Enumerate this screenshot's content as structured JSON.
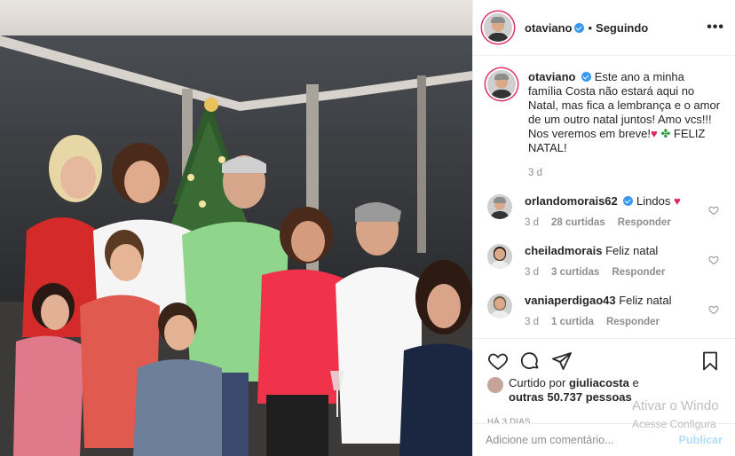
{
  "header": {
    "username": "otaviano",
    "separator": "•",
    "follow_status": "Seguindo",
    "more": "•••"
  },
  "caption": {
    "username": "otaviano",
    "text": "Este ano a minha família Costa não estará aqui no Natal, mas fica a lembrança e o amor de um outro natal juntos! Amo vcs!!! Nos veremos em breve!",
    "heart": "♥",
    "clover": "✤",
    "text_end": "FELIZ NATAL!",
    "time": "3 d"
  },
  "comments": [
    {
      "username": "orlandomorais62",
      "verified": true,
      "text": "Lindos",
      "emoji": "♥",
      "time": "3 d",
      "likes": "28 curtidas",
      "reply": "Responder"
    },
    {
      "username": "cheiladmorais",
      "verified": false,
      "text": "Feliz natal",
      "emoji": "",
      "time": "3 d",
      "likes": "3 curtidas",
      "reply": "Responder"
    },
    {
      "username": "vaniaperdigao43",
      "verified": false,
      "text": "Feliz natal",
      "emoji": "",
      "time": "3 d",
      "likes": "1 curtida",
      "reply": "Responder"
    }
  ],
  "likes": {
    "prefix": "Curtido por",
    "user": "giuliacosta",
    "conj": "e",
    "others": "outras 50.737 pessoas"
  },
  "posted_ago": "HÁ 3 DIAS",
  "add_comment": {
    "placeholder": "Adicione um comentário...",
    "post": "Publicar"
  },
  "watermark": {
    "line1": "Ativar o Windo",
    "line2": "Acesse Configura"
  },
  "icons": [
    "heart-icon",
    "comment-icon",
    "share-icon",
    "bookmark-icon",
    "more-icon",
    "verified-icon"
  ],
  "colors": {
    "verified": "#3897f0",
    "link_disabled": "#b2dffc",
    "muted": "#8e8e8e",
    "heart": "#e0245e"
  }
}
